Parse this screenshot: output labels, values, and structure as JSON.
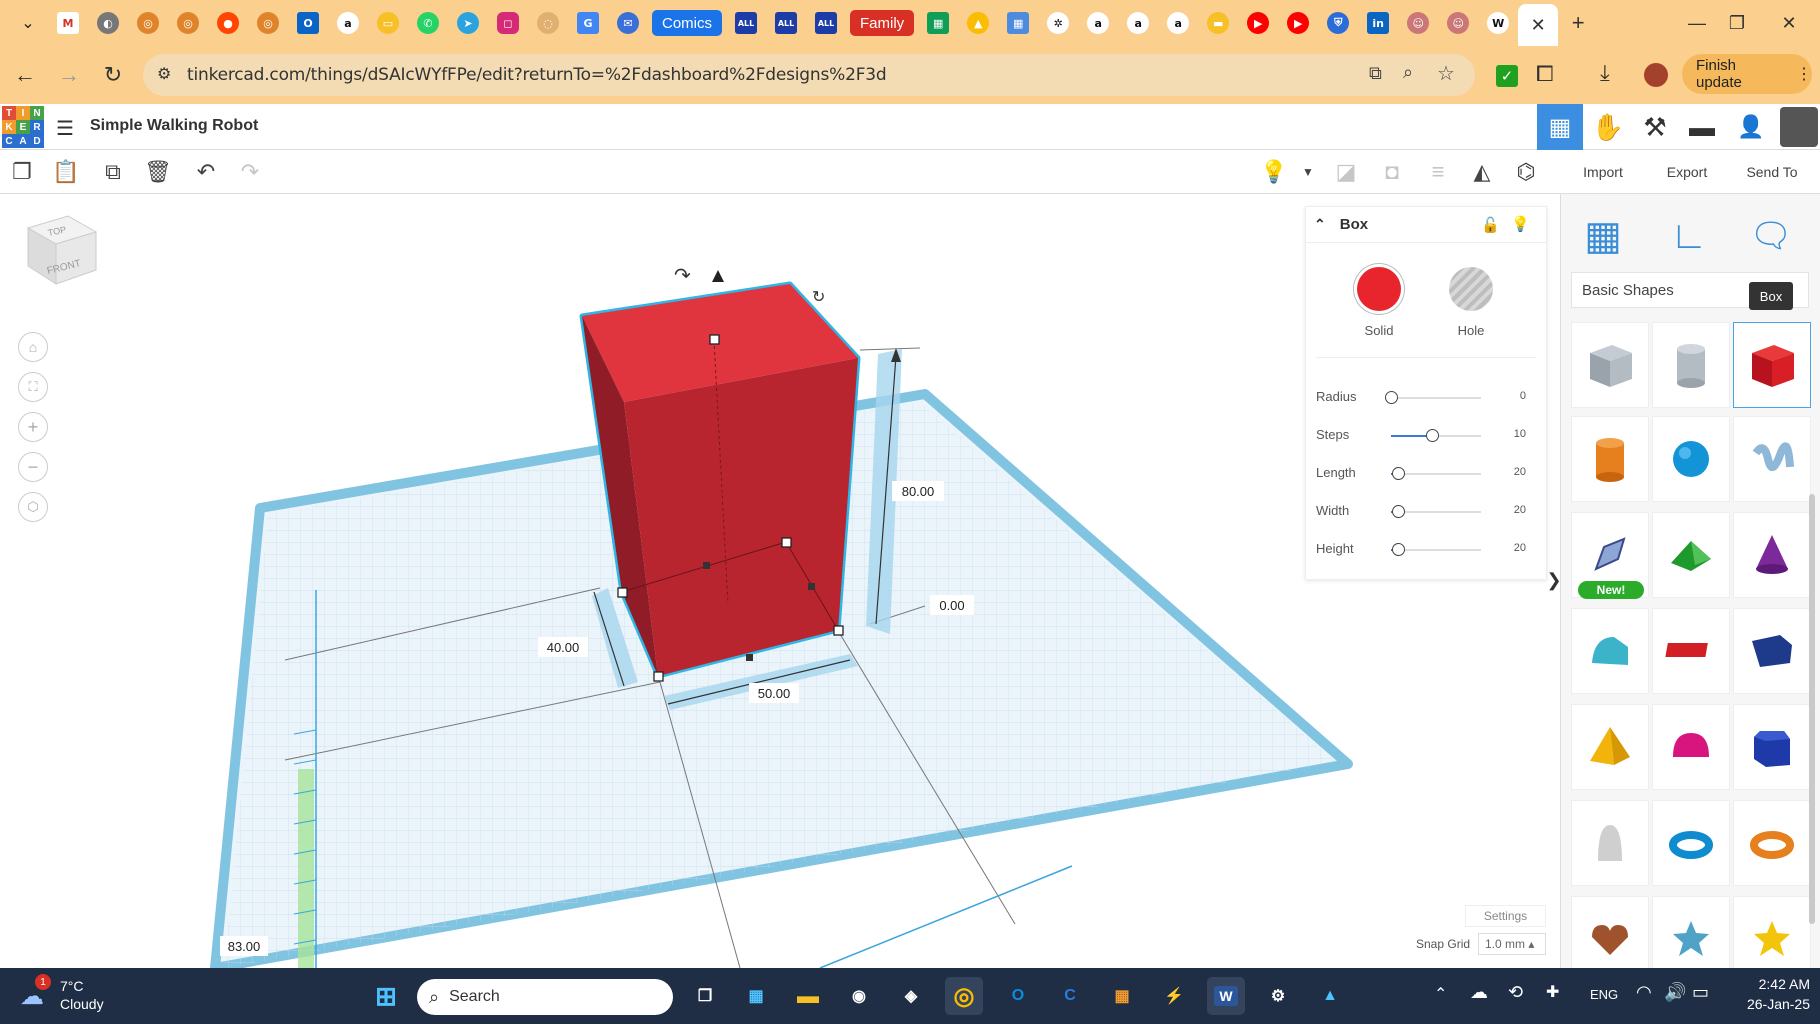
{
  "browser": {
    "tab_pills": {
      "comics": "Comics",
      "family": "Family",
      "all_1": "ALL",
      "all_2": "ALL",
      "all_3": "ALL"
    },
    "url": "tinkercad.com/things/dSAIcWYfFPe/edit?returnTo=%2Fdashboard%2Fdesigns%2F3d",
    "finish_update": "Finish update",
    "accent_color": "#fbcf8e"
  },
  "app": {
    "logo_letters": [
      "T",
      "I",
      "N",
      "K",
      "E",
      "R",
      "C",
      "A",
      "D"
    ],
    "design_title": "Simple Walking Robot",
    "toolbar": {
      "import": "Import",
      "export": "Export",
      "send_to": "Send To"
    }
  },
  "viewcube": {
    "top": "TOP",
    "front": "FRONT"
  },
  "workplane": {
    "dim_height": "80.00",
    "dim_elevation": "0.00",
    "dim_width": "40.00",
    "dim_length": "50.00",
    "ruler_value": "83.00",
    "shape_color": "#d9323e"
  },
  "inspector": {
    "title": "Box",
    "solid_label": "Solid",
    "hole_label": "Hole",
    "solid_color": "#e8242d",
    "params": [
      {
        "name": "Radius",
        "value": "0",
        "fraction": 0.0
      },
      {
        "name": "Steps",
        "value": "10",
        "fraction": 0.45
      },
      {
        "name": "Length",
        "value": "20",
        "fraction": 0.08
      },
      {
        "name": "Width",
        "value": "20",
        "fraction": 0.08
      },
      {
        "name": "Height",
        "value": "20",
        "fraction": 0.08
      }
    ]
  },
  "shapes_panel": {
    "library": "Basic Shapes",
    "tooltip": "Box",
    "new_badge": "New!"
  },
  "bottom": {
    "settings": "Settings",
    "snap_grid_label": "Snap Grid",
    "snap_grid_value": "1.0 mm ▴"
  },
  "taskbar": {
    "weather_temp": "7°C",
    "weather_desc": "Cloudy",
    "weather_badge": "1",
    "search_placeholder": "Search",
    "language": "ENG",
    "time": "2:42 AM",
    "date": "26-Jan-25"
  }
}
